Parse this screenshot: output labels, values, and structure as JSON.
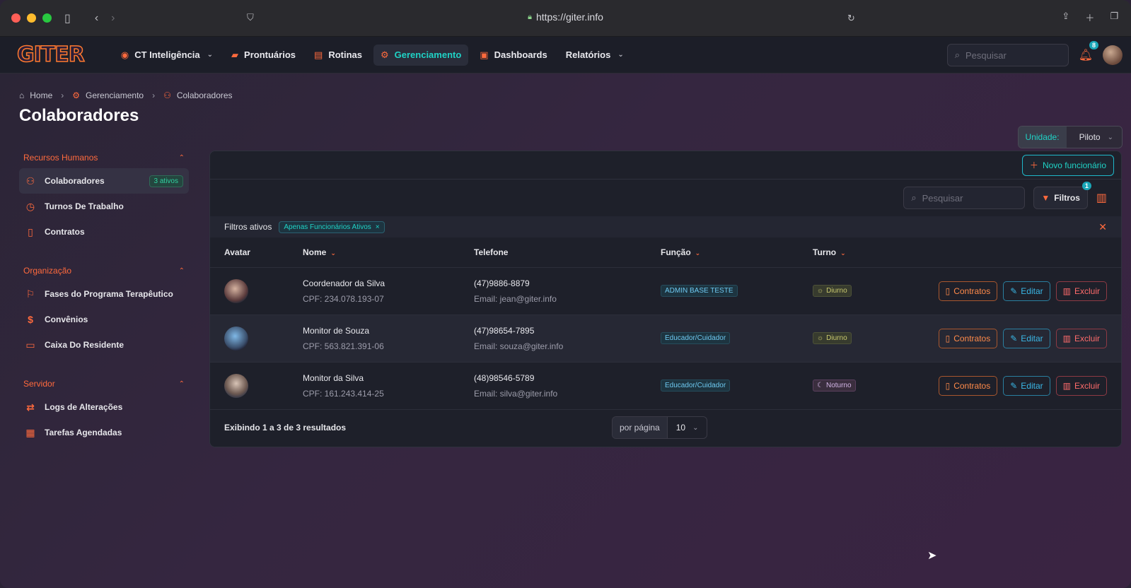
{
  "browser": {
    "url": "https://giter.info"
  },
  "app": {
    "logo": "GITER"
  },
  "nav": {
    "items": [
      {
        "label": "CT Inteligência",
        "icon": "org-avatar-icon",
        "dropdown": true
      },
      {
        "label": "Prontuários",
        "icon": "folder-icon"
      },
      {
        "label": "Rotinas",
        "icon": "routine-icon"
      },
      {
        "label": "Gerenciamento",
        "icon": "gear-icon",
        "active": true
      },
      {
        "label": "Dashboards",
        "icon": "dashboard-icon"
      },
      {
        "label": "Relatórios",
        "icon": "",
        "dropdown": true
      }
    ],
    "search_placeholder": "Pesquisar",
    "notification_count": "8"
  },
  "breadcrumb": [
    "Home",
    "Gerenciamento",
    "Colaboradores"
  ],
  "page": {
    "title": "Colaboradores",
    "unit_label": "Unidade:",
    "unit_value": "Piloto"
  },
  "sidebar": {
    "groups": [
      {
        "title": "Recursos Humanos",
        "items": [
          {
            "label": "Colaboradores",
            "badge": "3 ativos",
            "active": true
          },
          {
            "label": "Turnos De Trabalho"
          },
          {
            "label": "Contratos"
          }
        ]
      },
      {
        "title": "Organização",
        "items": [
          {
            "label": "Fases do Programa Terapêutico"
          },
          {
            "label": "Convênios"
          },
          {
            "label": "Caixa Do Residente"
          }
        ]
      },
      {
        "title": "Servidor",
        "items": [
          {
            "label": "Logs de Alterações"
          },
          {
            "label": "Tarefas Agendadas"
          }
        ]
      }
    ]
  },
  "toolbar": {
    "new_label": "Novo funcionário",
    "search_placeholder": "Pesquisar",
    "filters_label": "Filtros",
    "filters_count": "1"
  },
  "filters": {
    "label": "Filtros ativos",
    "chip": "Apenas Funcionários Ativos"
  },
  "table": {
    "headers": {
      "avatar": "Avatar",
      "name": "Nome",
      "phone": "Telefone",
      "role": "Função",
      "shift": "Turno"
    },
    "rows": [
      {
        "name": "Coordenador da Silva",
        "cpf": "CPF: 234.078.193-07",
        "phone": "(47)9886-8879",
        "email": "Email: jean@giter.info",
        "role": "ADMIN BASE TESTE",
        "shift": "Diurno"
      },
      {
        "name": "Monitor de Souza",
        "cpf": "CPF: 563.821.391-06",
        "phone": "(47)98654-7895",
        "email": "Email: souza@giter.info",
        "role": "Educador/Cuidador",
        "shift": "Diurno"
      },
      {
        "name": "Monitor da Silva",
        "cpf": "CPF: 161.243.414-25",
        "phone": "(48)98546-5789",
        "email": "Email: silva@giter.info",
        "role": "Educador/Cuidador",
        "shift": "Noturno"
      }
    ],
    "actions": {
      "contracts": "Contratos",
      "edit": "Editar",
      "delete": "Excluir"
    }
  },
  "pagination": {
    "summary": "Exibindo 1 a 3 de 3 resultados",
    "per_page_label": "por página",
    "per_page_value": "10"
  }
}
